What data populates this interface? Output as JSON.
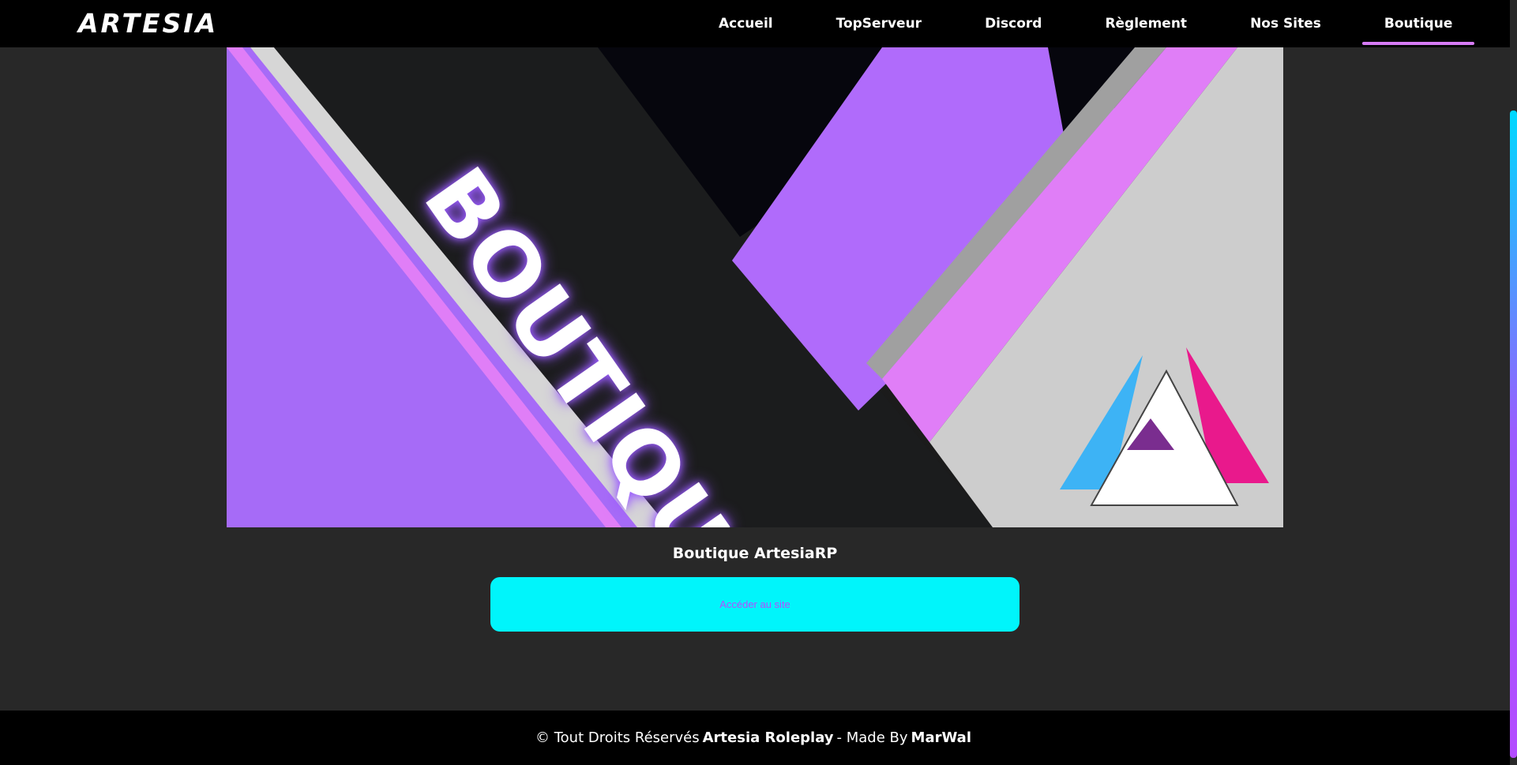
{
  "header": {
    "logo": "ARTESIA",
    "nav": [
      {
        "label": "Accueil"
      },
      {
        "label": "TopServeur"
      },
      {
        "label": "Discord"
      },
      {
        "label": "Règlement"
      },
      {
        "label": "Nos Sites"
      },
      {
        "label": "Boutique",
        "active": true
      }
    ]
  },
  "banner": {
    "word": "BOUTIQUE"
  },
  "main": {
    "title": "Boutique ArtesiaRP",
    "button_label": "Accéder au site"
  },
  "footer": {
    "prefix": "© Tout Droits Réservés",
    "brand": "Artesia Roleplay",
    "middle": "- Made By",
    "author": "MarWal"
  },
  "colors": {
    "accent_purple": "#d67bf5",
    "button_cyan": "#00f5fb",
    "background": "#282828"
  }
}
